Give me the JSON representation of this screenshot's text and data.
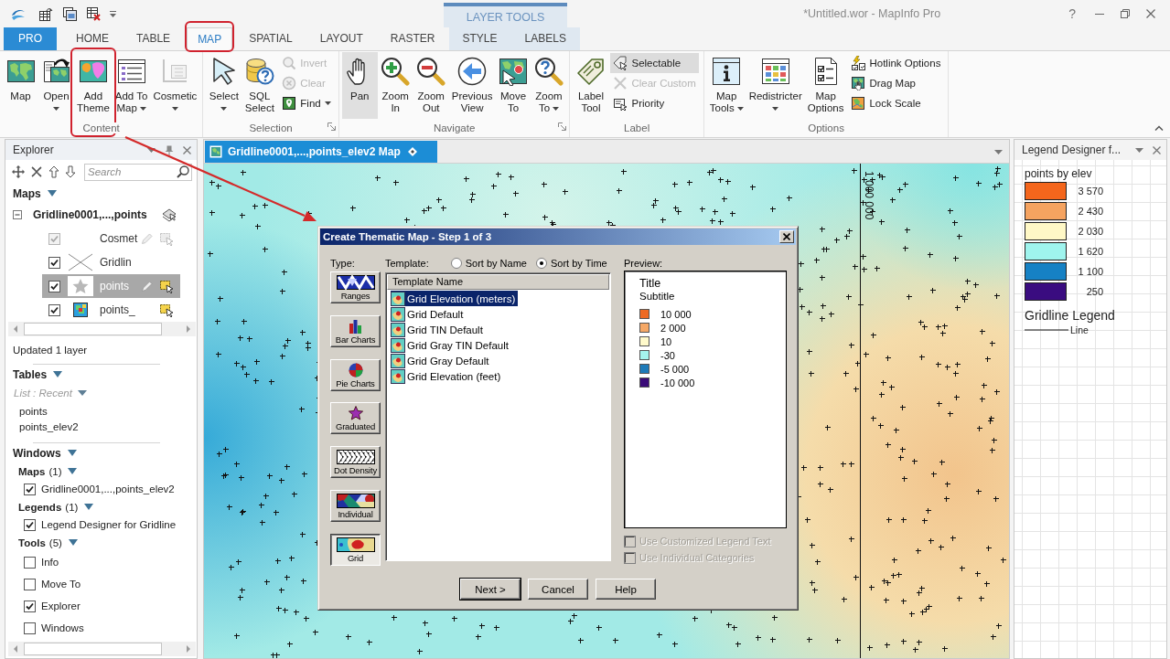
{
  "title_bar": {
    "title": "*Untitled.wor - MapInfo Pro",
    "context_group": "LAYER TOOLS",
    "help": "?"
  },
  "tabs": [
    {
      "label": "PRO",
      "kind": "file",
      "selected": false,
      "highlighted": false
    },
    {
      "label": "HOME",
      "kind": "main",
      "selected": false,
      "highlighted": false
    },
    {
      "label": "TABLE",
      "kind": "main",
      "selected": false,
      "highlighted": false
    },
    {
      "label": "MAP",
      "kind": "main",
      "selected": true,
      "highlighted": true
    },
    {
      "label": "SPATIAL",
      "kind": "main",
      "selected": false,
      "highlighted": false
    },
    {
      "label": "LAYOUT",
      "kind": "main",
      "selected": false,
      "highlighted": false
    },
    {
      "label": "RASTER",
      "kind": "main",
      "selected": false,
      "highlighted": false
    },
    {
      "label": "STYLE",
      "kind": "contextual",
      "selected": false,
      "highlighted": false
    },
    {
      "label": "LABELS",
      "kind": "contextual",
      "selected": false,
      "highlighted": false
    }
  ],
  "ribbon": {
    "groups": [
      {
        "label": "Content",
        "launcher": false,
        "buttons": [
          {
            "kind": "large",
            "label": "Map",
            "menu": false,
            "disabled": false,
            "selected": false,
            "highlighted": false
          },
          {
            "kind": "large",
            "label": "Open",
            "menu": true,
            "disabled": false,
            "selected": false,
            "highlighted": false
          },
          {
            "kind": "large",
            "label": "Add Theme",
            "menu": false,
            "disabled": false,
            "selected": false,
            "highlighted": true
          },
          {
            "kind": "large",
            "label": "Add To Map",
            "menu": true,
            "disabled": false,
            "selected": false,
            "highlighted": false
          },
          {
            "kind": "large",
            "label": "Cosmetic",
            "menu": true,
            "disabled": false,
            "selected": false,
            "highlighted": false
          }
        ]
      },
      {
        "label": "Selection",
        "launcher": true,
        "buttons": [
          {
            "kind": "large",
            "label": "Select",
            "menu": true,
            "disabled": false,
            "selected": false,
            "highlighted": false
          },
          {
            "kind": "large",
            "label": "SQL Select",
            "menu": false,
            "disabled": false,
            "selected": false,
            "highlighted": false
          },
          {
            "kind": "small",
            "label": "Invert",
            "menu": false,
            "disabled": true,
            "selected": false,
            "highlighted": false
          },
          {
            "kind": "small",
            "label": "Clear",
            "menu": false,
            "disabled": true,
            "selected": false,
            "highlighted": false
          },
          {
            "kind": "small",
            "label": "Find",
            "menu": true,
            "disabled": false,
            "selected": false,
            "highlighted": false
          }
        ]
      },
      {
        "label": "Navigate",
        "launcher": true,
        "buttons": [
          {
            "kind": "large",
            "label": "Pan",
            "menu": false,
            "disabled": false,
            "selected": true,
            "highlighted": false
          },
          {
            "kind": "large",
            "label": "Zoom In",
            "menu": false,
            "disabled": false,
            "selected": false,
            "highlighted": false
          },
          {
            "kind": "large",
            "label": "Zoom Out",
            "menu": false,
            "disabled": false,
            "selected": false,
            "highlighted": false
          },
          {
            "kind": "large",
            "label": "Previous View",
            "menu": false,
            "disabled": false,
            "selected": false,
            "highlighted": false
          },
          {
            "kind": "large",
            "label": "Move To",
            "menu": false,
            "disabled": false,
            "selected": false,
            "highlighted": false
          },
          {
            "kind": "large",
            "label": "Zoom To",
            "menu": true,
            "disabled": false,
            "selected": false,
            "highlighted": false
          }
        ]
      },
      {
        "label": "Label",
        "launcher": false,
        "buttons": [
          {
            "kind": "large",
            "label": "Label Tool",
            "menu": false,
            "disabled": false,
            "selected": false,
            "highlighted": false
          },
          {
            "kind": "small",
            "label": "Selectable",
            "menu": false,
            "disabled": false,
            "selected": true,
            "highlighted": false
          },
          {
            "kind": "small",
            "label": "Clear Custom",
            "menu": false,
            "disabled": true,
            "selected": false,
            "highlighted": false
          },
          {
            "kind": "small",
            "label": "Priority",
            "menu": false,
            "disabled": false,
            "selected": false,
            "highlighted": false
          }
        ]
      },
      {
        "label": "Options",
        "launcher": false,
        "buttons": [
          {
            "kind": "large",
            "label": "Map Tools",
            "menu": true,
            "disabled": false,
            "selected": false,
            "highlighted": false
          },
          {
            "kind": "large",
            "label": "Redistricter",
            "menu": true,
            "disabled": false,
            "selected": false,
            "highlighted": false
          },
          {
            "kind": "large",
            "label": "Map Options",
            "menu": false,
            "disabled": false,
            "selected": false,
            "highlighted": false
          },
          {
            "kind": "small",
            "label": "Hotlink Options",
            "menu": false,
            "disabled": false,
            "selected": false,
            "highlighted": false
          },
          {
            "kind": "small",
            "label": "Drag Map",
            "menu": false,
            "disabled": false,
            "selected": false,
            "highlighted": false
          },
          {
            "kind": "small",
            "label": "Lock Scale",
            "menu": false,
            "disabled": false,
            "selected": false,
            "highlighted": false
          }
        ]
      }
    ]
  },
  "explorer": {
    "title": "Explorer",
    "search": {
      "placeholder": "Search"
    },
    "maps": {
      "title": "Maps",
      "expanded": true,
      "map": {
        "name": "Gridline0001,...,points",
        "expanded": true,
        "layers": [
          {
            "name": "Cosmet",
            "kind": "cosmetic",
            "checked": true,
            "disabled": true,
            "selected": false,
            "editable": true,
            "selectable": true
          },
          {
            "name": "Gridlin",
            "kind": "line",
            "checked": true,
            "disabled": false,
            "selected": false,
            "editable": false,
            "selectable": false
          },
          {
            "name": "points",
            "kind": "point",
            "checked": true,
            "disabled": false,
            "selected": true,
            "editable": true,
            "selectable": true
          },
          {
            "name": "points_",
            "kind": "grid",
            "checked": true,
            "disabled": false,
            "selected": false,
            "editable": false,
            "selectable": true
          }
        ]
      }
    },
    "status": "Updated 1 layer",
    "tables": {
      "title": "Tables",
      "expanded": true,
      "filter": "List : Recent",
      "items": [
        "points",
        "points_elev2"
      ]
    },
    "windows": {
      "title": "Windows",
      "expanded": true,
      "groups": [
        {
          "title": "Maps",
          "count": "(1)",
          "expanded": true,
          "items": [
            {
              "label": "Gridline0001,...,points_elev2",
              "checked": true
            }
          ]
        },
        {
          "title": "Legends",
          "count": "(1)",
          "expanded": true,
          "items": [
            {
              "label": "Legend Designer for Gridline",
              "checked": true
            }
          ]
        },
        {
          "title": "Tools",
          "count": "(5)",
          "expanded": true,
          "items": [
            {
              "label": "Info",
              "checked": false
            },
            {
              "label": "Move To",
              "checked": false
            },
            {
              "label": "Explorer",
              "checked": true
            },
            {
              "label": "Windows",
              "checked": false
            }
          ]
        }
      ]
    }
  },
  "map_window": {
    "tab_label": "Gridline0001,...,points_elev2 Map",
    "grid_label": "1 000 000"
  },
  "legend_panel": {
    "title": "Legend Designer f...",
    "legends": [
      {
        "title": "points by elev",
        "items": [
          {
            "kind": "swatch",
            "label": "3 570",
            "color": "#f4661c"
          },
          {
            "kind": "swatch",
            "label": "2 430",
            "color": "#f5a360"
          },
          {
            "kind": "swatch",
            "label": "2 030",
            "color": "#fff8c6"
          },
          {
            "kind": "swatch",
            "label": "1 620",
            "color": "#9ff4ee"
          },
          {
            "kind": "swatch",
            "label": "1 100",
            "color": "#1681c4"
          },
          {
            "kind": "swatch",
            "label": "250",
            "color": "#3a0c80"
          }
        ]
      },
      {
        "title": "Gridline Legend",
        "items": [
          {
            "kind": "line",
            "label": "Line"
          }
        ]
      }
    ]
  },
  "dialog": {
    "title": "Create Thematic Map - Step 1 of 3",
    "type_label": "Type:",
    "types": [
      {
        "label": "Ranges",
        "selected": false
      },
      {
        "label": "Bar Charts",
        "selected": false
      },
      {
        "label": "Pie Charts",
        "selected": false
      },
      {
        "label": "Graduated",
        "selected": false
      },
      {
        "label": "Dot Density",
        "selected": false
      },
      {
        "label": "Individual",
        "selected": false
      },
      {
        "label": "Grid",
        "selected": true
      }
    ],
    "template_label": "Template:",
    "sort_options": [
      {
        "label": "Sort by Name",
        "selected": false
      },
      {
        "label": "Sort by Time",
        "selected": true
      }
    ],
    "template_list": {
      "column": "Template Name",
      "items": [
        {
          "label": "Grid Elevation (meters)",
          "selected": true
        },
        {
          "label": "Grid Default",
          "selected": false
        },
        {
          "label": "Grid TIN Default",
          "selected": false
        },
        {
          "label": "Grid Gray TIN Default",
          "selected": false
        },
        {
          "label": "Grid Gray Default",
          "selected": false
        },
        {
          "label": "Grid Elevation (feet)",
          "selected": false
        }
      ]
    },
    "preview_label": "Preview:",
    "preview": {
      "title": "Title",
      "subtitle": "Subtitle",
      "items": [
        {
          "label": "10 000",
          "color": "#ee6a24"
        },
        {
          "label": "2 000",
          "color": "#f5a866"
        },
        {
          "label": "10",
          "color": "#fffacb"
        },
        {
          "label": "-30",
          "color": "#a5f4ee"
        },
        {
          "label": "-5 000",
          "color": "#1d7ab8"
        },
        {
          "label": "-10 000",
          "color": "#3a0b78"
        }
      ]
    },
    "options": [
      {
        "label": "Use Customized Legend Text",
        "checked": false,
        "disabled": true
      },
      {
        "label": "Use Individual Categories",
        "checked": false,
        "disabled": true
      }
    ],
    "buttons": [
      {
        "label": "Next >",
        "default": true
      },
      {
        "label": "Cancel",
        "default": false
      },
      {
        "label": "Help",
        "default": false
      }
    ]
  }
}
